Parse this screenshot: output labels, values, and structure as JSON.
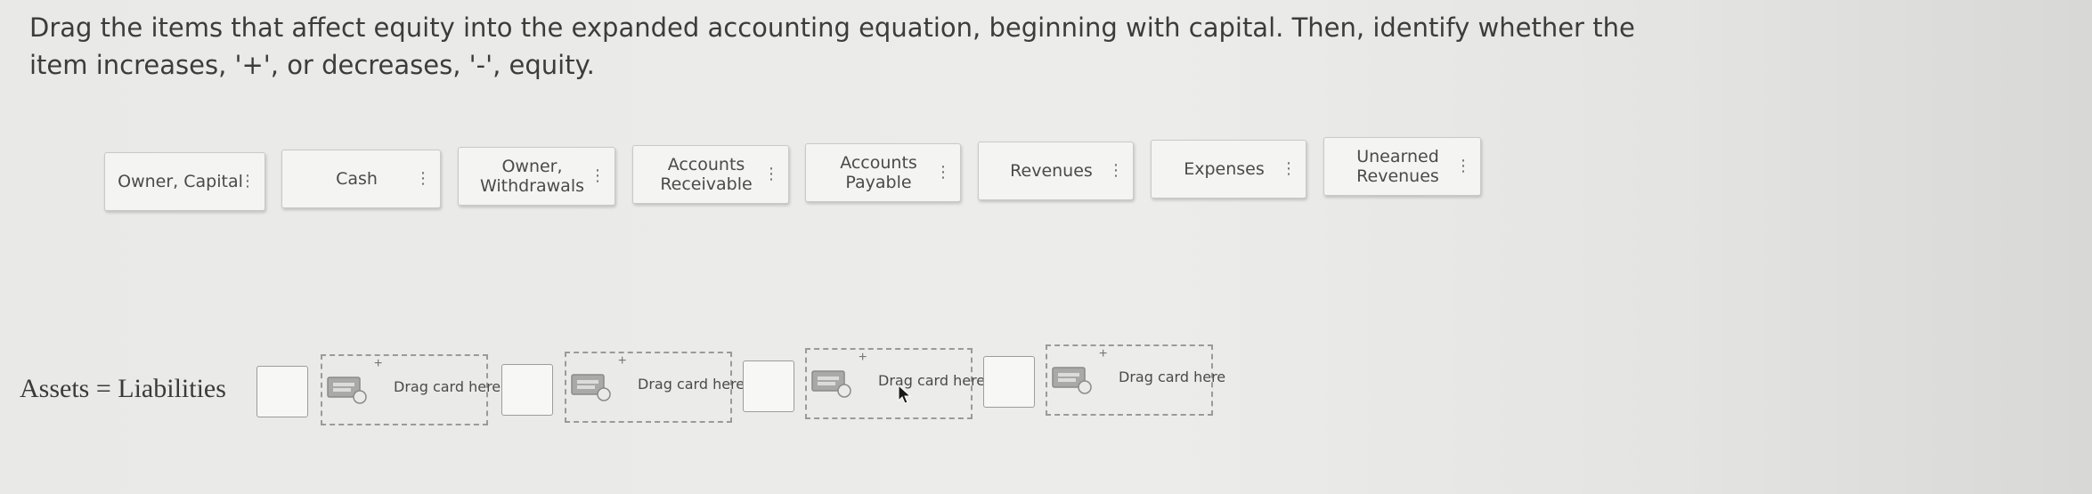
{
  "instructions": {
    "line1": "Drag the items that affect equity into the expanded accounting equation, beginning with capital. Then, identify whether the",
    "line2": "item increases, '+', or decreases, '-', equity."
  },
  "cards": [
    {
      "label": "Owner, Capital"
    },
    {
      "label": "Cash"
    },
    {
      "label": "Owner,\nWithdrawals"
    },
    {
      "label": "Accounts\nReceivable"
    },
    {
      "label": "Accounts\nPayable"
    },
    {
      "label": "Revenues"
    },
    {
      "label": "Expenses"
    },
    {
      "label": "Unearned\nRevenues"
    }
  ],
  "equation": {
    "label": "Assets = Liabilities",
    "dropzone_text": "Drag card here",
    "slots": 4
  },
  "icons": {
    "card_handle": "grip-dots-icon",
    "dropzone": "drag-card-icon",
    "cursor": "mouse-pointer-icon"
  },
  "colors": {
    "background": "#ebebe9",
    "card": "#f4f4f2",
    "dashed_border": "#9a9a98"
  }
}
